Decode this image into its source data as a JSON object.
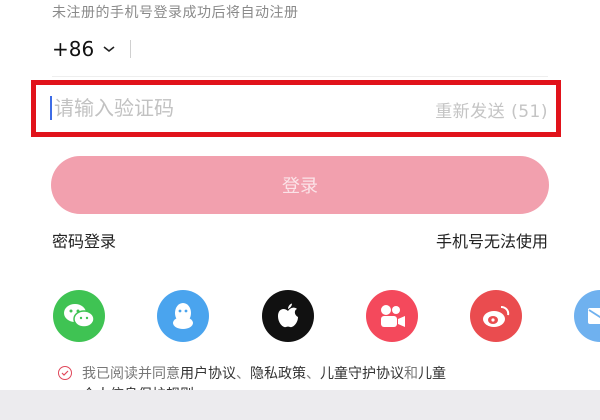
{
  "hint": "未注册的手机号登录成功后将自动注册",
  "phone": {
    "country_code": "+86"
  },
  "code_field": {
    "placeholder": "请输入验证码",
    "resend_label": "重新发送 (51)"
  },
  "login_button": "登录",
  "links": {
    "password_login": "密码登录",
    "phone_unavailable": "手机号无法使用"
  },
  "social_icons": [
    "wechat-icon",
    "qq-icon",
    "apple-icon",
    "kuaishou-icon",
    "weibo-icon",
    "mail-icon"
  ],
  "agreement": {
    "prefix": "我已阅读并同意",
    "user_agreement": "用户协议",
    "sep1": "、",
    "privacy_policy": "隐私政策",
    "sep2": "、",
    "child_protection": "儿童守护协议",
    "and": "和",
    "child_start": "儿童",
    "line2": "个人信息保护规则"
  },
  "colors": {
    "accent_red": "#e1131b",
    "button_pink": "#f2a0ae",
    "wechat_green": "#3fc353",
    "qq_blue": "#4aa4ee",
    "weibo_red": "#ea4c4f",
    "kuaishou_orange": "#f4495c"
  }
}
